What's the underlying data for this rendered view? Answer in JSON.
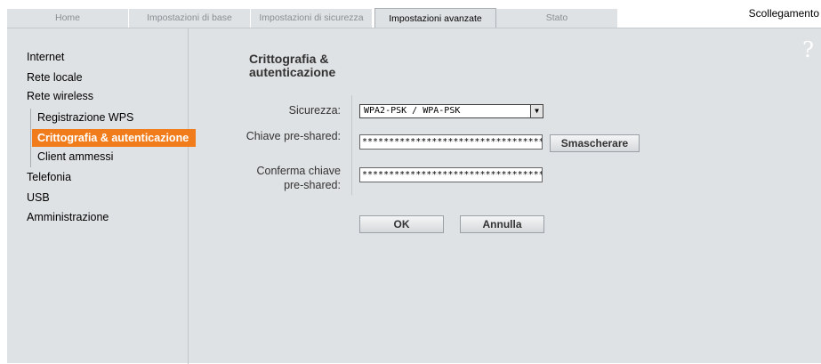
{
  "tabs": [
    "Home",
    "Impostazioni di base",
    "Impostazioni di sicurezza",
    "Impostazioni avanzate",
    "Stato"
  ],
  "active_tab": "Impostazioni avanzate",
  "logout_label": "Scollegamento",
  "sidebar": {
    "items": [
      "Internet",
      "Rete locale",
      "Rete wireless"
    ],
    "sub_items": [
      "Registrazione WPS",
      "Crittografia & autenticazione",
      "Client ammessi"
    ],
    "items_after": [
      "Telefonia",
      "USB",
      "Amministrazione"
    ]
  },
  "help_icon": "?",
  "section_title_line1": "Crittografia &",
  "section_title_line2": "autenticazione",
  "form": {
    "security_label": "Sicurezza:",
    "security_value": "WPA2-PSK / WPA-PSK",
    "psk_label": "Chiave pre-shared:",
    "psk_value": "************************************",
    "unmask_label": "Smascherare",
    "confirm_label_line1": "Conferma chiave",
    "confirm_label_line2": "pre-shared:",
    "confirm_value": "************************************",
    "ok_label": "OK",
    "cancel_label": "Annulla"
  },
  "colors": {
    "active_nav": "#f07c1c",
    "panel": "#dfe2e4"
  }
}
